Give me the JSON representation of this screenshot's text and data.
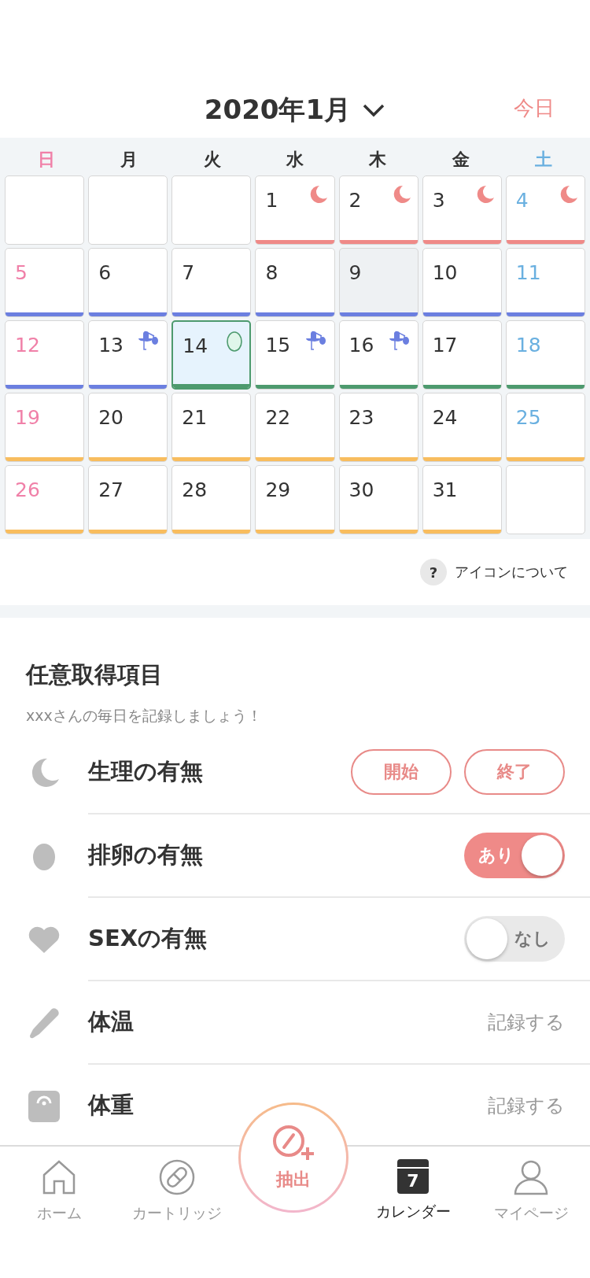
{
  "header": {
    "title": "2020年1月",
    "today_button": "今日"
  },
  "weekdays": [
    "日",
    "月",
    "火",
    "水",
    "木",
    "金",
    "土"
  ],
  "days": [
    {
      "kind": "empty"
    },
    {
      "kind": "empty"
    },
    {
      "kind": "empty"
    },
    {
      "day": "1",
      "kind": "moon",
      "color": "#ef8a88",
      "selected": false
    },
    {
      "day": "2",
      "kind": "moon",
      "color": "#ef8a88",
      "selected": false
    },
    {
      "day": "3",
      "kind": "moon",
      "color": "#ef8a88",
      "selected": false
    },
    {
      "day": "4",
      "kind": "moon",
      "color": "#ef8a88",
      "selected": false
    },
    {
      "day": "5",
      "kind": "plain",
      "color": "#6b7fe0",
      "selected": false
    },
    {
      "day": "6",
      "kind": "plain",
      "color": "#6b7fe0",
      "selected": false
    },
    {
      "day": "7",
      "kind": "plain",
      "color": "#6b7fe0",
      "selected": false
    },
    {
      "day": "8",
      "kind": "plain",
      "color": "#6b7fe0",
      "selected": false
    },
    {
      "day": "9",
      "kind": "plain",
      "color": "#6b7fe0",
      "selected": false,
      "today": true
    },
    {
      "day": "10",
      "kind": "plain",
      "color": "#6b7fe0",
      "selected": false
    },
    {
      "day": "11",
      "kind": "plain",
      "color": "#6b7fe0",
      "selected": false
    },
    {
      "day": "12",
      "kind": "plain",
      "color": "#6b7fe0",
      "selected": false
    },
    {
      "day": "13",
      "kind": "stork",
      "color": "#6b7fe0",
      "selected": false
    },
    {
      "day": "14",
      "kind": "egg",
      "color": "#4d9a6e",
      "selected": true
    },
    {
      "day": "15",
      "kind": "stork",
      "color": "#4d9a6e",
      "selected": false
    },
    {
      "day": "16",
      "kind": "stork",
      "color": "#4d9a6e",
      "selected": false
    },
    {
      "day": "17",
      "kind": "plain",
      "color": "#4d9a6e",
      "selected": false
    },
    {
      "day": "18",
      "kind": "plain",
      "color": "#4d9a6e",
      "selected": false
    },
    {
      "day": "19",
      "kind": "plain",
      "color": "#f8bd5e",
      "selected": false
    },
    {
      "day": "20",
      "kind": "plain",
      "color": "#f8bd5e",
      "selected": false
    },
    {
      "day": "21",
      "kind": "plain",
      "color": "#f8bd5e",
      "selected": false
    },
    {
      "day": "22",
      "kind": "plain",
      "color": "#f8bd5e",
      "selected": false
    },
    {
      "day": "23",
      "kind": "plain",
      "color": "#f8bd5e",
      "selected": false
    },
    {
      "day": "24",
      "kind": "plain",
      "color": "#f8bd5e",
      "selected": false
    },
    {
      "day": "25",
      "kind": "plain",
      "color": "#f8bd5e",
      "selected": false
    },
    {
      "day": "26",
      "kind": "plain",
      "color": "#f8bd5e",
      "selected": false
    },
    {
      "day": "27",
      "kind": "plain",
      "color": "#f8bd5e",
      "selected": false
    },
    {
      "day": "28",
      "kind": "plain",
      "color": "#f8bd5e",
      "selected": false
    },
    {
      "day": "29",
      "kind": "plain",
      "color": "#f8bd5e",
      "selected": false
    },
    {
      "day": "30",
      "kind": "plain",
      "color": "#f8bd5e",
      "selected": false
    },
    {
      "day": "31",
      "kind": "plain",
      "color": "#f8bd5e",
      "selected": false
    },
    {
      "kind": "empty"
    }
  ],
  "help": {
    "icon_text": "?",
    "label": "アイコンについて"
  },
  "section": {
    "title": "任意取得項目",
    "subtitle": "xxxさんの毎日を記録しましょう！"
  },
  "rows": [
    {
      "kind": "buttons",
      "label": "生理の有無",
      "buttons": [
        "開始",
        "終了"
      ]
    },
    {
      "kind": "toggle",
      "label": "排卵の有無",
      "on": true,
      "value": "あり"
    },
    {
      "kind": "toggle",
      "label": "SEXの有無",
      "on": false,
      "value": "なし"
    },
    {
      "kind": "record",
      "label": "体温",
      "action": "記録する"
    },
    {
      "kind": "record",
      "label": "体重",
      "action": "記録する"
    }
  ],
  "nav": [
    {
      "kind": "tab",
      "label": "ホーム",
      "selected": false
    },
    {
      "kind": "tab",
      "label": "カートリッジ",
      "selected": false
    },
    {
      "kind": "center",
      "label": "抽出"
    },
    {
      "kind": "tab",
      "label": "カレンダー",
      "selected": true,
      "icon_text": "7"
    },
    {
      "kind": "tab",
      "label": "マイページ",
      "selected": false
    }
  ]
}
